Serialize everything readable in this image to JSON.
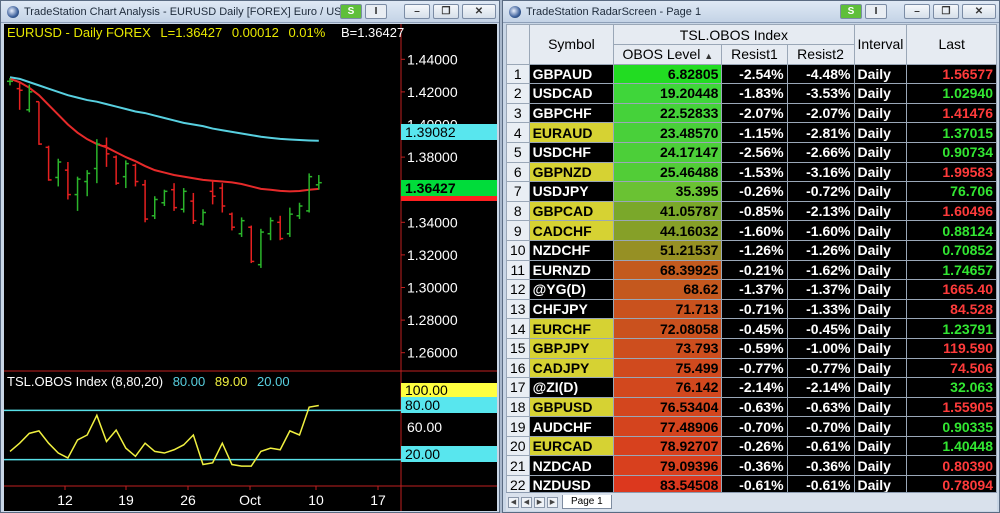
{
  "chart_window": {
    "title": "TradeStation Chart Analysis - EURUSD Daily [FOREX] Euro / US Dollar",
    "btn_s": "S",
    "btn_i": "I",
    "header": {
      "symbol": "EURUSD - Daily  FOREX",
      "last": "L=1.36427",
      "change": "0.00012",
      "pct": "0.01%",
      "bid": "B=1.36427"
    },
    "price_axis": [
      "1.44000",
      "1.42000",
      "1.40000",
      "1.38000",
      "1.36000",
      "1.34000",
      "1.32000",
      "1.30000",
      "1.28000",
      "1.26000"
    ],
    "price_tags": {
      "cyan": "1.39082",
      "green": "1.36427",
      "red": "1.36"
    },
    "osc_header": {
      "title": "TSL.OBOS Index (8,80,20)",
      "ob": "80.00",
      "mid": "89.00",
      "os": "20.00"
    },
    "osc_axis": [
      "100.00",
      "80.00",
      "60.00",
      "20.00"
    ],
    "x_axis": [
      "12",
      "19",
      "26",
      "Oct",
      "10",
      "17"
    ],
    "colors": {
      "up": "#2bb52b",
      "down": "#e62020",
      "ma_fast": "#e62a2a",
      "ma_slow": "#58d0e0",
      "osc": "#f0f040",
      "levels": "#58e0e8"
    },
    "chart_data": {
      "type": "candlestick",
      "ohlc": [
        [
          1.4265,
          1.4285,
          1.424,
          1.4265
        ],
        [
          1.422,
          1.4265,
          1.409,
          1.421
        ],
        [
          1.409,
          1.4245,
          1.4075,
          1.42
        ],
        [
          1.414,
          1.414,
          1.3875,
          1.388
        ],
        [
          1.386,
          1.387,
          1.3655,
          1.366
        ],
        [
          1.3675,
          1.379,
          1.362,
          1.377
        ],
        [
          1.372,
          1.377,
          1.354,
          1.357
        ],
        [
          1.357,
          1.368,
          1.347,
          1.3665
        ],
        [
          1.365,
          1.372,
          1.356,
          1.37
        ],
        [
          1.373,
          1.391,
          1.364,
          1.388
        ],
        [
          1.387,
          1.392,
          1.374,
          1.382
        ],
        [
          1.38,
          1.381,
          1.363,
          1.364
        ],
        [
          1.368,
          1.378,
          1.361,
          1.376
        ],
        [
          1.375,
          1.376,
          1.362,
          1.365
        ],
        [
          1.363,
          1.366,
          1.34,
          1.342
        ],
        [
          1.344,
          1.356,
          1.342,
          1.354
        ],
        [
          1.352,
          1.36,
          1.35,
          1.359
        ],
        [
          1.36,
          1.364,
          1.347,
          1.349
        ],
        [
          1.348,
          1.361,
          1.346,
          1.359
        ],
        [
          1.353,
          1.358,
          1.339,
          1.341
        ],
        [
          1.339,
          1.348,
          1.338,
          1.346
        ],
        [
          1.359,
          1.366,
          1.351,
          1.356
        ],
        [
          1.361,
          1.364,
          1.346,
          1.35
        ],
        [
          1.345,
          1.346,
          1.335,
          1.337
        ],
        [
          1.333,
          1.343,
          1.331,
          1.341
        ],
        [
          1.337,
          1.338,
          1.315,
          1.316
        ],
        [
          1.314,
          1.336,
          1.312,
          1.334
        ],
        [
          1.333,
          1.343,
          1.329,
          1.341
        ],
        [
          1.34,
          1.344,
          1.329,
          1.33
        ],
        [
          1.333,
          1.349,
          1.331,
          1.345
        ],
        [
          1.344,
          1.352,
          1.342,
          1.35
        ],
        [
          1.347,
          1.37,
          1.346,
          1.368
        ],
        [
          1.363,
          1.369,
          1.36,
          1.3643
        ]
      ],
      "ma_slow": [
        1.429,
        1.428,
        1.426,
        1.424,
        1.422,
        1.42,
        1.418,
        1.4165,
        1.415,
        1.414,
        1.4125,
        1.411,
        1.4095,
        1.408,
        1.407,
        1.4055,
        1.404,
        1.4025,
        1.401,
        1.4,
        1.399,
        1.3975,
        1.3965,
        1.3955,
        1.3945,
        1.3935,
        1.3925,
        1.3918,
        1.3912,
        1.3908,
        1.3905,
        1.3902,
        1.39
      ],
      "ma_fast": [
        1.428,
        1.426,
        1.4225,
        1.418,
        1.412,
        1.406,
        1.4,
        1.395,
        1.391,
        1.388,
        1.386,
        1.383,
        1.38,
        1.3775,
        1.3745,
        1.372,
        1.3705,
        1.369,
        1.368,
        1.367,
        1.366,
        1.3655,
        1.365,
        1.3645,
        1.3635,
        1.362,
        1.3605,
        1.36,
        1.3593,
        1.359,
        1.3592,
        1.36,
        1.3605
      ],
      "osc": [
        30,
        40,
        52,
        55,
        40,
        28,
        22,
        44,
        50,
        74,
        42,
        56,
        34,
        24,
        40,
        30,
        28,
        32,
        38,
        50,
        14,
        16,
        40,
        14,
        12,
        12,
        30,
        34,
        32,
        55,
        50,
        84,
        86
      ],
      "price_range": [
        1.25,
        1.45
      ],
      "osc_range": [
        0,
        100
      ],
      "osc_levels": [
        80,
        20
      ]
    }
  },
  "radar_window": {
    "title": "TradeStation RadarScreen - Page 1",
    "btn_s": "S",
    "btn_i": "I",
    "headers": {
      "symbol": "Symbol",
      "group": "TSL.OBOS Index",
      "obos": "OBOS Level",
      "r1": "Resist1",
      "r2": "Resist2",
      "interval": "Interval",
      "last": "Last"
    },
    "rows": [
      {
        "n": "1",
        "sym": "GBPAUD",
        "hl": false,
        "obos": "6.82805",
        "bg": "#22dc22",
        "r1": "-2.54%",
        "r2": "-4.48%",
        "iv": "Daily",
        "last": "1.56577",
        "lc": "#ff3b3b"
      },
      {
        "n": "2",
        "sym": "USDCAD",
        "hl": false,
        "obos": "19.20448",
        "bg": "#3fd63a",
        "r1": "-1.83%",
        "r2": "-3.53%",
        "iv": "Daily",
        "last": "1.02940",
        "lc": "#32e632"
      },
      {
        "n": "3",
        "sym": "GBPCHF",
        "hl": false,
        "obos": "22.52833",
        "bg": "#45d23a",
        "r1": "-2.07%",
        "r2": "-2.07%",
        "iv": "Daily",
        "last": "1.41476",
        "lc": "#ff3b3b"
      },
      {
        "n": "4",
        "sym": "EURAUD",
        "hl": true,
        "obos": "23.48570",
        "bg": "#49d03a",
        "r1": "-1.15%",
        "r2": "-2.81%",
        "iv": "Daily",
        "last": "1.37015",
        "lc": "#32e632"
      },
      {
        "n": "5",
        "sym": "USDCHF",
        "hl": false,
        "obos": "24.17147",
        "bg": "#4ccf39",
        "r1": "-2.56%",
        "r2": "-2.66%",
        "iv": "Daily",
        "last": "0.90734",
        "lc": "#32e632"
      },
      {
        "n": "6",
        "sym": "GBPNZD",
        "hl": true,
        "obos": "25.46488",
        "bg": "#52cd37",
        "r1": "-1.53%",
        "r2": "-3.16%",
        "iv": "Daily",
        "last": "1.99583",
        "lc": "#ff3b3b"
      },
      {
        "n": "7",
        "sym": "USDJPY",
        "hl": false,
        "obos": "35.395",
        "bg": "#6ac233",
        "r1": "-0.26%",
        "r2": "-0.72%",
        "iv": "Daily",
        "last": "76.706",
        "lc": "#32e632"
      },
      {
        "n": "8",
        "sym": "GBPCAD",
        "hl": true,
        "obos": "41.05787",
        "bg": "#7aa82a",
        "r1": "-0.85%",
        "r2": "-2.13%",
        "iv": "Daily",
        "last": "1.60496",
        "lc": "#ff3b3b"
      },
      {
        "n": "9",
        "sym": "CADCHF",
        "hl": true,
        "obos": "44.16032",
        "bg": "#86a028",
        "r1": "-1.60%",
        "r2": "-1.60%",
        "iv": "Daily",
        "last": "0.88124",
        "lc": "#32e632"
      },
      {
        "n": "10",
        "sym": "NZDCHF",
        "hl": false,
        "obos": "51.21537",
        "bg": "#969024",
        "r1": "-1.26%",
        "r2": "-1.26%",
        "iv": "Daily",
        "last": "0.70852",
        "lc": "#32e632"
      },
      {
        "n": "11",
        "sym": "EURNZD",
        "hl": false,
        "obos": "68.39925",
        "bg": "#c35a1e",
        "r1": "-0.21%",
        "r2": "-1.62%",
        "iv": "Daily",
        "last": "1.74657",
        "lc": "#32e632"
      },
      {
        "n": "12",
        "sym": "@YG(D)",
        "hl": false,
        "obos": "68.62",
        "bg": "#c4581e",
        "r1": "-1.37%",
        "r2": "-1.37%",
        "iv": "Daily",
        "last": "1665.40",
        "lc": "#ff3b3b"
      },
      {
        "n": "13",
        "sym": "CHFJPY",
        "hl": false,
        "obos": "71.713",
        "bg": "#c9521e",
        "r1": "-0.71%",
        "r2": "-1.33%",
        "iv": "Daily",
        "last": "84.528",
        "lc": "#ff3b3b"
      },
      {
        "n": "14",
        "sym": "EURCHF",
        "hl": true,
        "obos": "72.08058",
        "bg": "#ca511e",
        "r1": "-0.45%",
        "r2": "-0.45%",
        "iv": "Daily",
        "last": "1.23791",
        "lc": "#32e632"
      },
      {
        "n": "15",
        "sym": "GBPJPY",
        "hl": true,
        "obos": "73.793",
        "bg": "#cd4e1e",
        "r1": "-0.59%",
        "r2": "-1.00%",
        "iv": "Daily",
        "last": "119.590",
        "lc": "#ff3b3b"
      },
      {
        "n": "16",
        "sym": "CADJPY",
        "hl": true,
        "obos": "75.499",
        "bg": "#d04a1e",
        "r1": "-0.77%",
        "r2": "-0.77%",
        "iv": "Daily",
        "last": "74.506",
        "lc": "#ff3b3b"
      },
      {
        "n": "17",
        "sym": "@ZI(D)",
        "hl": false,
        "obos": "76.142",
        "bg": "#d2481e",
        "r1": "-2.14%",
        "r2": "-2.14%",
        "iv": "Daily",
        "last": "32.063",
        "lc": "#32e632"
      },
      {
        "n": "18",
        "sym": "GBPUSD",
        "hl": true,
        "obos": "76.53404",
        "bg": "#d3461e",
        "r1": "-0.63%",
        "r2": "-0.63%",
        "iv": "Daily",
        "last": "1.55905",
        "lc": "#ff3b3b"
      },
      {
        "n": "19",
        "sym": "AUDCHF",
        "hl": false,
        "obos": "77.48906",
        "bg": "#d4441e",
        "r1": "-0.70%",
        "r2": "-0.70%",
        "iv": "Daily",
        "last": "0.90335",
        "lc": "#32e632"
      },
      {
        "n": "20",
        "sym": "EURCAD",
        "hl": true,
        "obos": "78.92707",
        "bg": "#d7411e",
        "r1": "-0.26%",
        "r2": "-0.61%",
        "iv": "Daily",
        "last": "1.40448",
        "lc": "#32e632"
      },
      {
        "n": "21",
        "sym": "NZDCAD",
        "hl": false,
        "obos": "79.09396",
        "bg": "#d8401e",
        "r1": "-0.36%",
        "r2": "-0.36%",
        "iv": "Daily",
        "last": "0.80390",
        "lc": "#ff3b3b"
      },
      {
        "n": "22",
        "sym": "NZDUSD",
        "hl": false,
        "obos": "83.54508",
        "bg": "#dc381e",
        "r1": "-0.61%",
        "r2": "-0.61%",
        "iv": "Daily",
        "last": "0.78094",
        "lc": "#ff3b3b"
      }
    ],
    "page_tab": "Page 1"
  }
}
